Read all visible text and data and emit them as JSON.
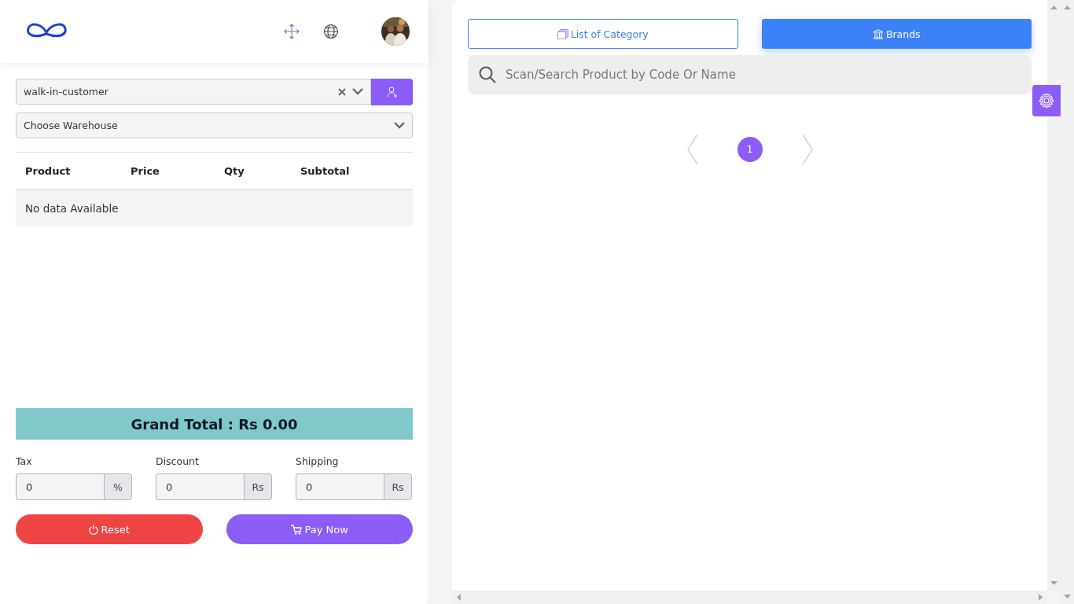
{
  "customer": {
    "value": "walk-in-customer"
  },
  "warehouse": {
    "placeholder": "Choose Warehouse"
  },
  "table": {
    "columns": [
      "Product",
      "Price",
      "Qty",
      "Subtotal"
    ],
    "empty_text": "No data Available"
  },
  "grand_total": "Grand Total : Rs 0.00",
  "adjustments": [
    {
      "label": "Tax",
      "value": "0",
      "unit": "%"
    },
    {
      "label": "Discount",
      "value": "0",
      "unit": "Rs"
    },
    {
      "label": "Shipping",
      "value": "0",
      "unit": "Rs"
    }
  ],
  "actions": [
    {
      "kind": "reset",
      "label": "Reset"
    },
    {
      "kind": "pay",
      "label": "Pay Now"
    }
  ],
  "tabs": [
    {
      "kind": "category",
      "label": "List of Category",
      "selected": false
    },
    {
      "kind": "brands",
      "label": "Brands",
      "selected": true
    }
  ],
  "search": {
    "placeholder": "Scan/Search Product by Code Or Name"
  },
  "pagination": [
    {
      "label": "1",
      "selected": true
    }
  ]
}
